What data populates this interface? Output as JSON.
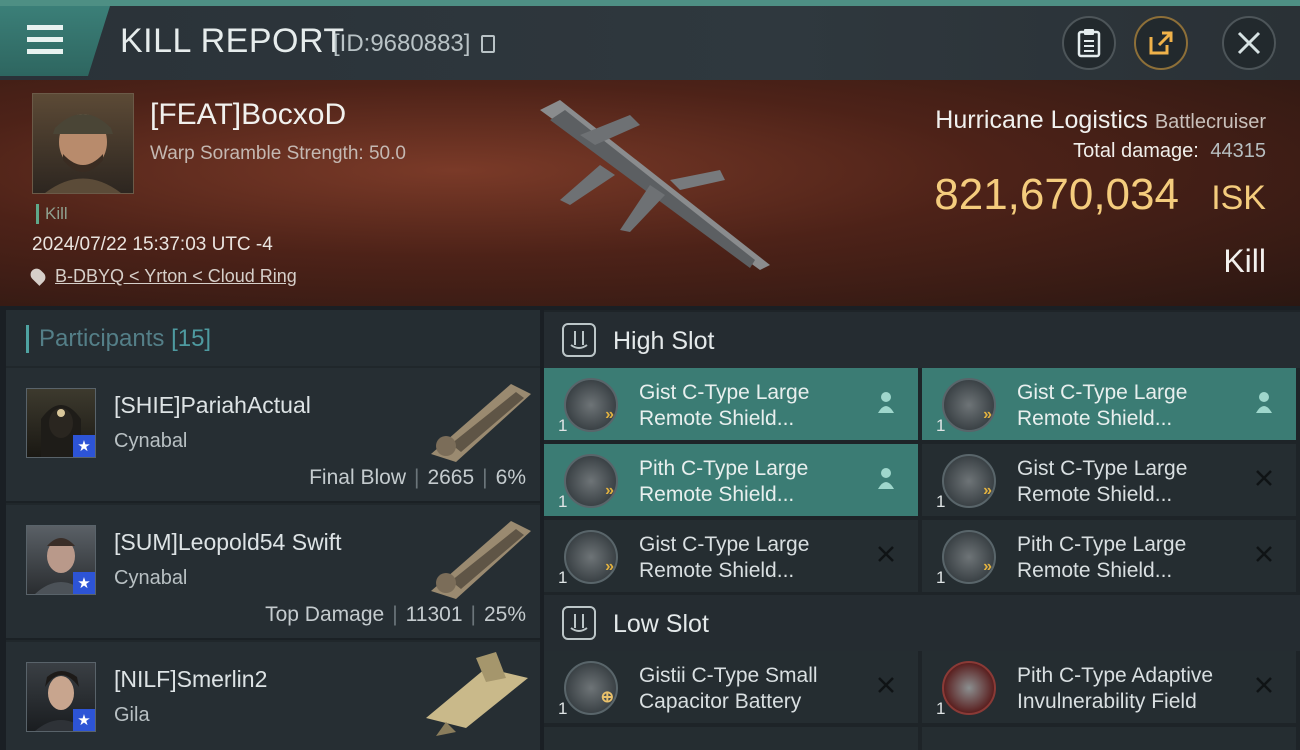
{
  "header": {
    "title": "KILL REPORT",
    "id_text": "[ID:9680883]"
  },
  "victim": {
    "name": "[FEAT]BocxoD",
    "warp_scramble": "Warp Soramble Strength: 50.0",
    "tag": "Kill",
    "timestamp": "2024/07/22 15:37:03 UTC -4",
    "location": "B-DBYQ < Yrton < Cloud Ring",
    "ship_name": "Hurricane Logistics",
    "ship_class": "Battlecruiser",
    "total_damage_label": "Total damage:",
    "total_damage": "44315",
    "isk_value": "821,670,034",
    "isk_unit": "ISK",
    "result": "Kill"
  },
  "participants": {
    "label": "Participants",
    "count": "[15]",
    "rows": [
      {
        "name": "[SHIE]PariahActual",
        "ship": "Cynabal",
        "stat_label": "Final Blow",
        "damage": "2665",
        "percent": "6%"
      },
      {
        "name": "[SUM]Leopold54 Swift",
        "ship": "Cynabal",
        "stat_label": "Top Damage",
        "damage": "11301",
        "percent": "25%"
      },
      {
        "name": "[NILF]Smerlin2",
        "ship": "Gila"
      }
    ]
  },
  "slots": {
    "high": {
      "title": "High Slot",
      "modules": [
        {
          "line1": "Gist C-Type Large",
          "line2": "Remote Shield...",
          "qty": "1",
          "state": "active"
        },
        {
          "line1": "Gist C-Type Large",
          "line2": "Remote Shield...",
          "qty": "1",
          "state": "active"
        },
        {
          "line1": "Pith C-Type Large",
          "line2": "Remote Shield...",
          "qty": "1",
          "state": "active"
        },
        {
          "line1": "Gist C-Type Large",
          "line2": "Remote Shield...",
          "qty": "1",
          "state": "destroyed"
        },
        {
          "line1": "Gist C-Type Large",
          "line2": "Remote Shield...",
          "qty": "1",
          "state": "destroyed"
        },
        {
          "line1": "Pith C-Type Large",
          "line2": "Remote Shield...",
          "qty": "1",
          "state": "destroyed"
        }
      ]
    },
    "low": {
      "title": "Low Slot",
      "modules": [
        {
          "line1": "Gistii C-Type Small",
          "line2": "Capacitor Battery",
          "qty": "1",
          "state": "destroyed"
        },
        {
          "line1": "Pith C-Type Adaptive",
          "line2": "Invulnerability Field",
          "qty": "1",
          "state": "destroyed"
        }
      ]
    }
  }
}
